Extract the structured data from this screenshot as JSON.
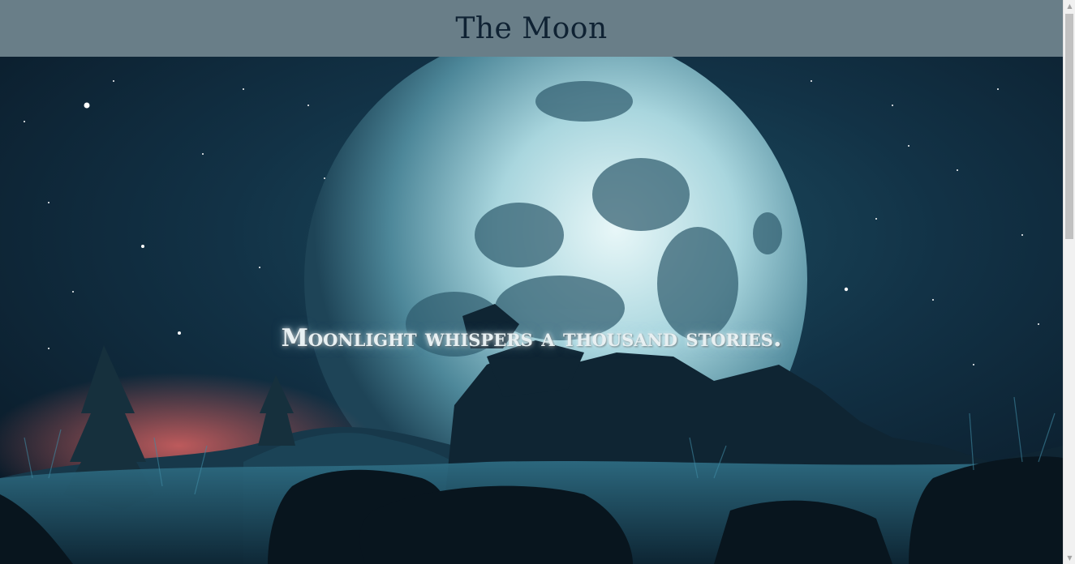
{
  "header": {
    "title": "The Moon",
    "background": "#697e88",
    "title_color": "#0f2233"
  },
  "hero": {
    "tagline": "Moonlight whispers a thousand stories.",
    "image_subject": "night-landscape-full-moon",
    "sky_color": "#0f2a3c",
    "moon_color": "#cfe9ee",
    "horizon_glow": "#c05a5a"
  },
  "scrollbar": {
    "up_icon": "chevron-up-icon",
    "down_icon": "chevron-down-icon",
    "position_fraction": 0
  }
}
